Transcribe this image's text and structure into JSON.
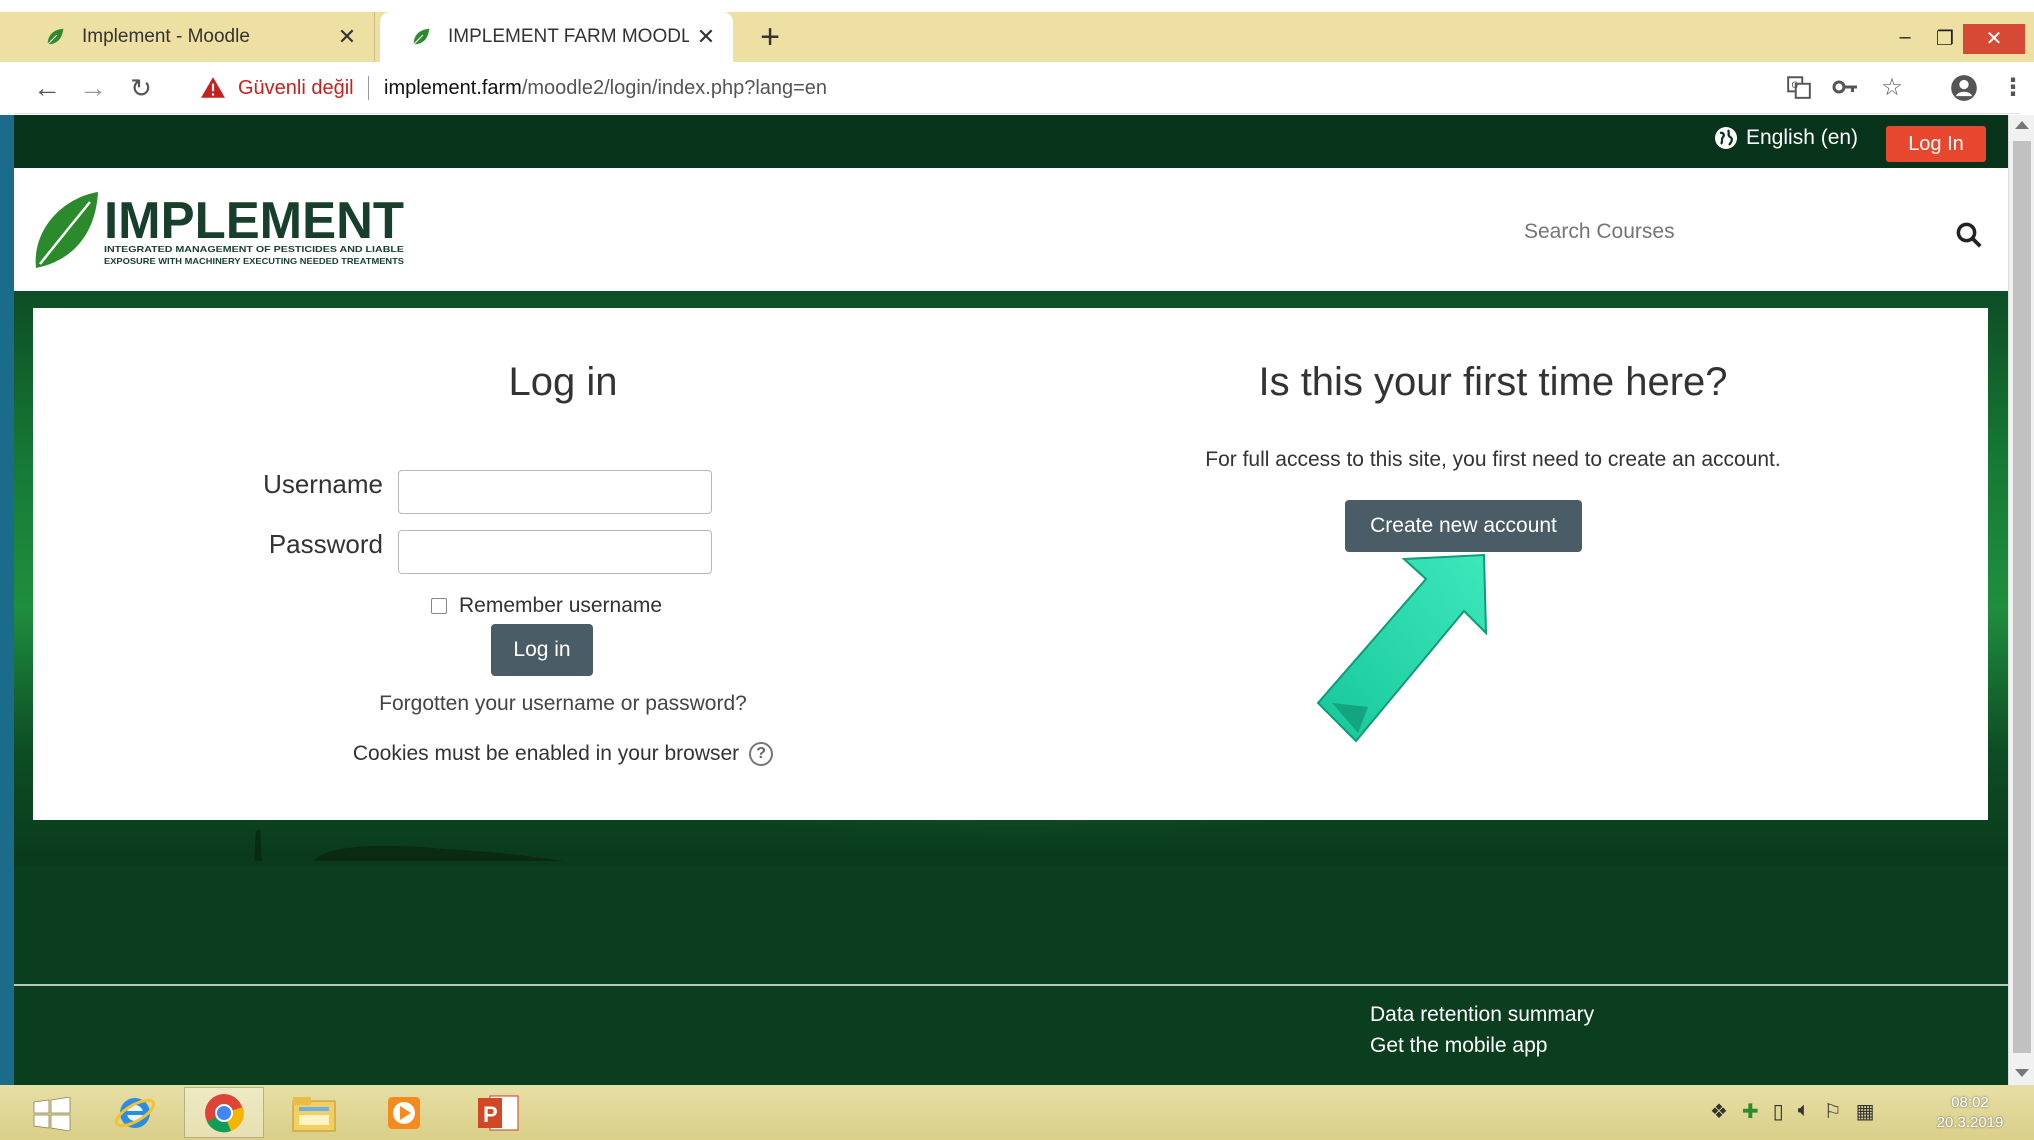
{
  "browser": {
    "tabs": [
      {
        "title": "Implement - Moodle",
        "active": false
      },
      {
        "title": "IMPLEMENT FARM MOODLE: Lo",
        "active": true
      }
    ],
    "new_tab_label": "+",
    "security_label": "Güvenli değil",
    "url_host": "implement.farm",
    "url_path": "/moodle2/login/index.php?lang=en",
    "window_controls": {
      "minimize": "–",
      "restore": "❐",
      "close": "✕"
    }
  },
  "site": {
    "language": "English (en)",
    "login_top_label": "Log In",
    "logo": {
      "name": "IMPLEMENT",
      "tagline_1": "INTEGRATED MANAGEMENT OF PESTICIDES AND LIABLE",
      "tagline_2": "EXPOSURE WITH MACHINERY EXECUTING NEEDED TREATMENTS"
    },
    "search_placeholder": "Search Courses"
  },
  "login": {
    "heading": "Log in",
    "username_label": "Username",
    "username_value": "",
    "password_label": "Password",
    "password_value": "",
    "remember_label": "Remember username",
    "remember_checked": false,
    "button_label": "Log in",
    "forgot_link": "Forgotten your username or password?",
    "cookies_text": "Cookies must be enabled in your browser",
    "help_icon": "?"
  },
  "signup": {
    "heading": "Is this your first time here?",
    "text": "For full access to this site, you first need to create an account.",
    "button_label": "Create new account"
  },
  "footer": {
    "data_retention": "Data retention summary",
    "mobile_app": "Get the mobile app"
  },
  "taskbar": {
    "apps": [
      "internet-explorer",
      "chrome",
      "file-explorer",
      "media-player",
      "powerpoint"
    ],
    "active_app": "chrome",
    "clock_time": "08:02",
    "clock_date": "20.3.2019"
  },
  "colors": {
    "brand_dark_green": "#0b3d1f",
    "accent_red": "#e8472f",
    "button_slate": "#4a5d66",
    "annotation_arrow": "#1ed6a8",
    "tab_bar": "#ede0a2"
  }
}
